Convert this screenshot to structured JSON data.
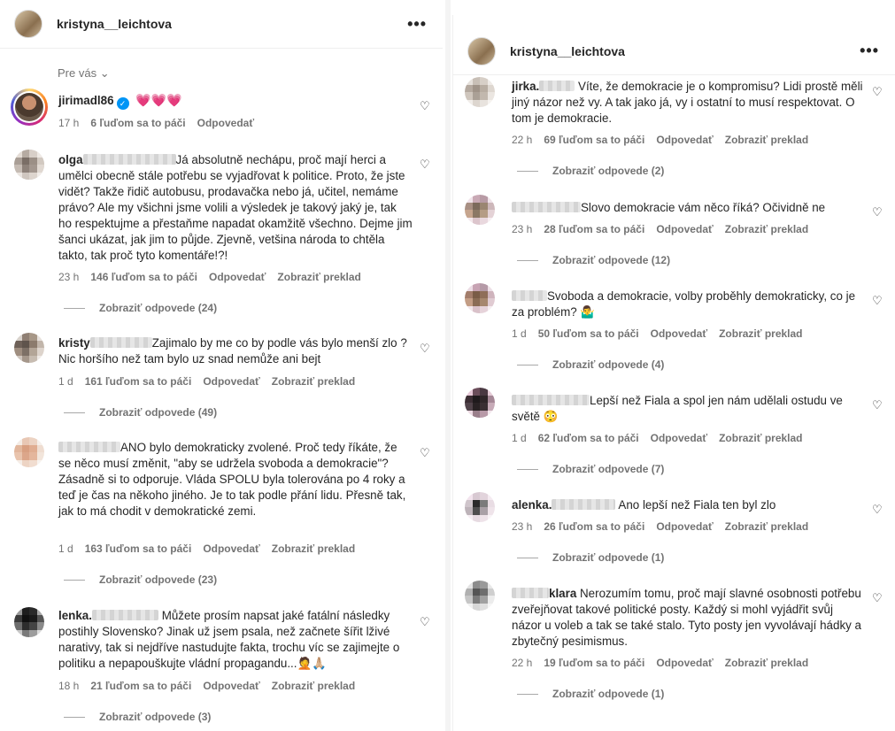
{
  "left": {
    "header": {
      "username": "kristyna__leichtova",
      "more": "•••"
    },
    "sort_label": "Pre vás",
    "comments": [
      {
        "user": "jirimadl86",
        "verified": true,
        "text": "💗💗💗",
        "time": "17 h",
        "likes": "6 ľuďom sa to páči",
        "reply": "Odpovedať",
        "translate": ""
      },
      {
        "user": "olga",
        "text": "Já absolutně nechápu, proč mají herci a umělci obecně stále potřebu se vyjadřovat k politice. Proto, že jste vidět? Takže řidič autobusu, prodavačka nebo já, učitel, nemáme právo? Ale my všichni jsme volili a výsledek je takový jaký je, tak ho respektujme a přestaňme napadat okamžitě všechno. Dejme jim šanci ukázat, jak jim to půjde. Zjevně, vetšina národa to chtěla takto, tak proč tyto komentáře!?!",
        "time": "23 h",
        "likes": "146 ľuďom sa to páči",
        "reply": "Odpovedať",
        "translate": "Zobraziť preklad",
        "replies": "Zobraziť odpovede (24)"
      },
      {
        "user": "kristy",
        "text": "Zajimalo by me co by podle vás bylo menší zlo ? Nic horšího než tam bylo uz snad nemůže ani bejt",
        "time": "1 d",
        "likes": "161 ľuďom sa to páči",
        "reply": "Odpovedať",
        "translate": "Zobraziť preklad",
        "replies": "Zobraziť odpovede (49)"
      },
      {
        "user": "",
        "text": "ANO bylo demokraticky zvolené. Proč tedy říkáte, že se něco musí změnit, \"aby se udržela svoboda a demokracie\"? Zásadně si to odporuje. Vláda SPOLU byla tolerována po 4 roky a teď je čas na někoho jiného. Je to tak podle přání lidu. Přesně tak, jak to má chodit v demokratické zemi.",
        "time": "1 d",
        "likes": "163 ľuďom sa to páči",
        "reply": "Odpovedať",
        "translate": "Zobraziť preklad",
        "replies": "Zobraziť odpovede (23)"
      },
      {
        "user": "lenka.",
        "text": "Můžete prosím napsat jaké fatální následky postihly Slovensko? Jinak už jsem psala, než začnete šířit lživé narativy, tak si nejdříve nastudujte fakta, trochu víc se zajimejte o politiku a nepapouškujte vládní propagandu...🤦🙏🏼",
        "time": "18 h",
        "likes": "21 ľuďom sa to páči",
        "reply": "Odpovedať",
        "translate": "Zobraziť preklad",
        "replies": "Zobraziť odpovede (3)"
      }
    ]
  },
  "right": {
    "header": {
      "username": "kristyna__leichtova",
      "more": "•••"
    },
    "comments": [
      {
        "user": "jirka.",
        "text": "Víte, že demokracie je o kompromisu? Lidi prostě měli jiný názor než vy. A tak jako já, vy i ostatní to musí respektovat. O tom je demokracie.",
        "time": "22 h",
        "likes": "69 ľuďom sa to páči",
        "reply": "Odpovedať",
        "translate": "Zobraziť preklad",
        "replies": "Zobraziť odpovede (2)"
      },
      {
        "user": "",
        "text": "Slovo demokracie vám něco říká? Očividně ne",
        "time": "23 h",
        "likes": "28 ľuďom sa to páči",
        "reply": "Odpovedať",
        "translate": "Zobraziť preklad",
        "replies": "Zobraziť odpovede (12)"
      },
      {
        "user": "",
        "text": "Svoboda a demokracie, volby proběhly demokraticky, co je za problém? 🤷‍♂️",
        "time": "1 d",
        "likes": "50 ľuďom sa to páči",
        "reply": "Odpovedať",
        "translate": "Zobraziť preklad",
        "replies": "Zobraziť odpovede (4)"
      },
      {
        "user": "",
        "text": "Lepší než Fiala a spol jen nám udělali ostudu ve světě 😳",
        "time": "1 d",
        "likes": "62 ľuďom sa to páči",
        "reply": "Odpovedať",
        "translate": "Zobraziť preklad",
        "replies": "Zobraziť odpovede (7)"
      },
      {
        "user": "alenka.",
        "text": "Ano lepší než Fiala ten byl zlo",
        "time": "23 h",
        "likes": "26 ľuďom sa to páči",
        "reply": "Odpovedať",
        "translate": "Zobraziť preklad",
        "replies": "Zobraziť odpovede (1)"
      },
      {
        "user": "klara",
        "text": "Nerozumím tomu, proč mají slavné osobnosti potřebu zveřejňovat takové politické posty. Každý si mohl vyjádřit svůj názor u voleb a tak se také stalo. Tyto posty jen vyvolávají hádky a zbytečný pesimismus.",
        "time": "22 h",
        "likes": "19 ľuďom sa to páči",
        "reply": "Odpovedať",
        "translate": "Zobraziť preklad",
        "replies": "Zobraziť odpovede (1)"
      }
    ]
  }
}
